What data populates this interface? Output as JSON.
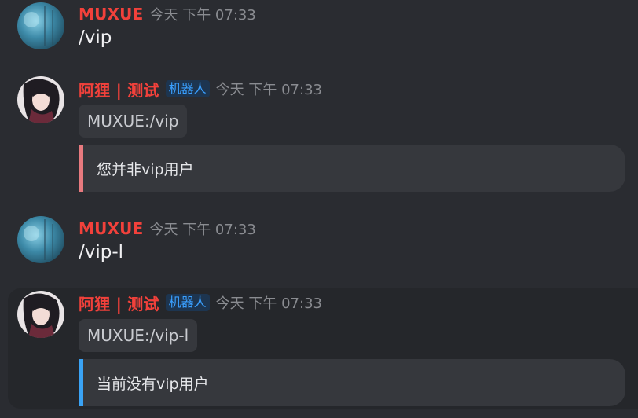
{
  "colors": {
    "username": "#f2413b",
    "error_bar": "#e87a7f",
    "info_bar": "#3aa3f5"
  },
  "messages": [
    {
      "author": "MUXUE",
      "time": "今天 下午 07:33",
      "text": "/vip"
    },
    {
      "author": "阿狸 | 测试",
      "badge": "机器人",
      "time": "今天 下午 07:33",
      "command": "MUXUE:/vip",
      "reply": "您并非vip用户"
    },
    {
      "author": "MUXUE",
      "time": "今天 下午 07:33",
      "text": "/vip-l"
    },
    {
      "author": "阿狸 | 测试",
      "badge": "机器人",
      "time": "今天 下午 07:33",
      "command": "MUXUE:/vip-l",
      "reply": "当前没有vip用户"
    }
  ]
}
